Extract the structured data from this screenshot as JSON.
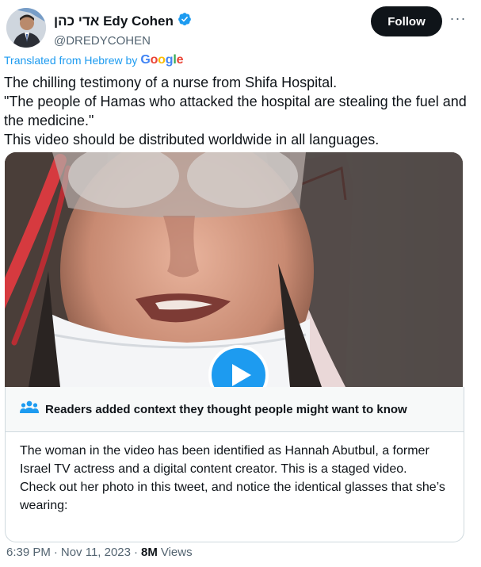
{
  "author": {
    "display_name": "אדי כהן Edy Cohen",
    "handle": "@DREDYCOHEN",
    "verified": true,
    "verified_color": "#1d9bf0"
  },
  "actions": {
    "follow_label": "Follow",
    "more_label": "···"
  },
  "translation": {
    "label": "Translated from Hebrew by",
    "provider": "Google"
  },
  "tweet": {
    "lines": [
      "The chilling testimony of a nurse from Shifa Hospital.",
      "\"The people of Hamas who attacked the hospital are stealing the fuel and the medicine.\"",
      "This video should be distributed worldwide in all languages."
    ]
  },
  "media": {
    "type": "video",
    "icon": "play-icon"
  },
  "community_note": {
    "icon": "people-icon",
    "title": "Readers added context they thought people might want to know",
    "paragraphs": [
      "The woman in the video has been identified as Hannah Abutbul, a former Israel TV actress and a digital content creator. This is a staged video.",
      "Check out her photo in this tweet, and notice the identical glasses that she’s wearing:"
    ]
  },
  "meta": {
    "time": "6:39 PM",
    "separator": "·",
    "date": "Nov 11, 2023",
    "views_count": "8M",
    "views_label": "Views"
  }
}
